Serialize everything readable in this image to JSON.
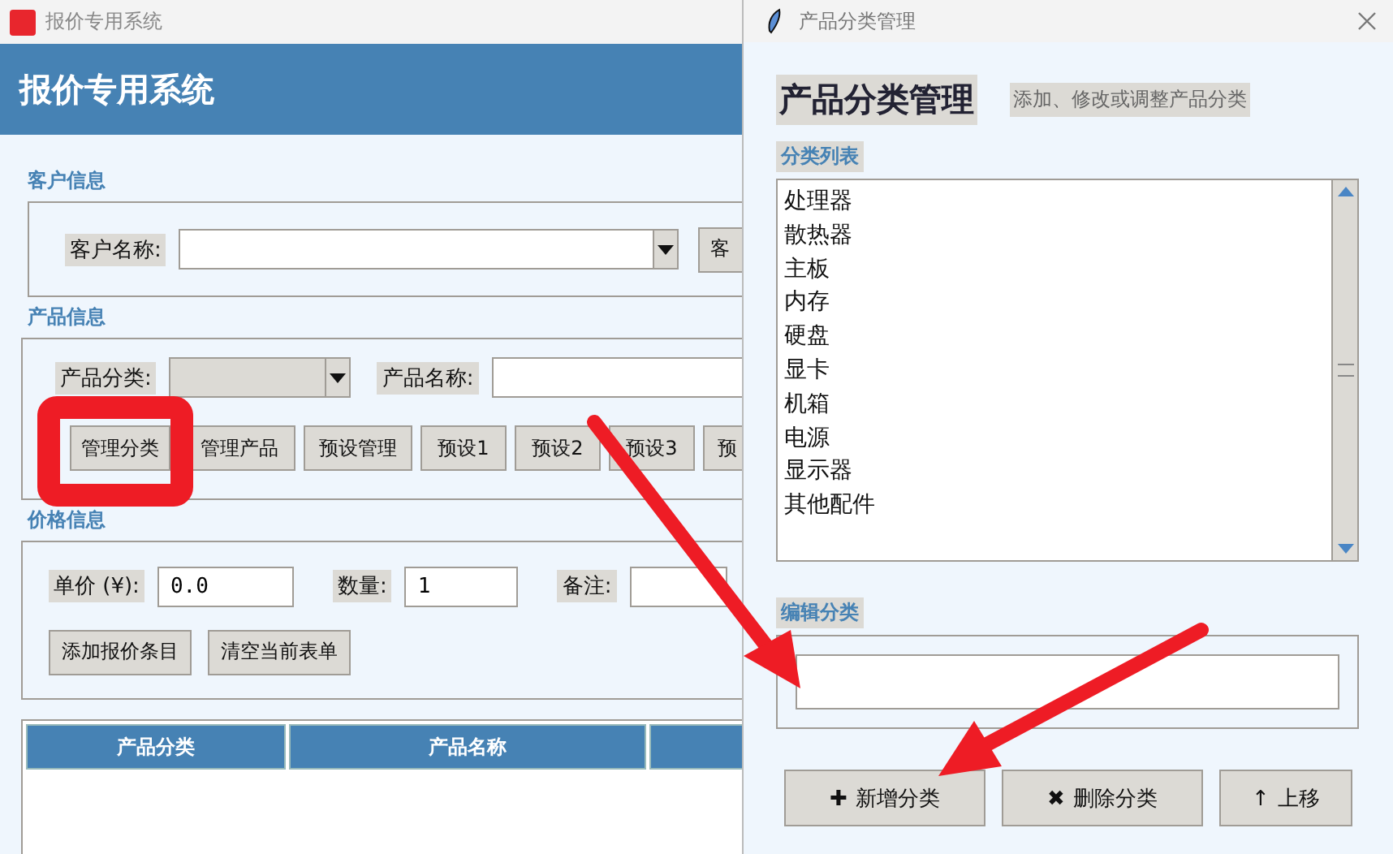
{
  "main_window": {
    "title": "报价专用系统",
    "header": "报价专用系统",
    "customer_section": {
      "label": "客户信息",
      "field_label": "客户名称:",
      "button": "客"
    },
    "product_section": {
      "label": "产品信息",
      "category_label": "产品分类:",
      "name_label": "产品名称:",
      "buttons": [
        "管理分类",
        "管理产品",
        "预设管理",
        "预设1",
        "预设2",
        "预设3",
        "预"
      ]
    },
    "price_section": {
      "label": "价格信息",
      "fields": [
        {
          "label": "单价 (¥):",
          "value": "0.0"
        },
        {
          "label": "数量:",
          "value": "1"
        },
        {
          "label": "备注:"
        }
      ],
      "buttons": [
        "添加报价条目",
        "清空当前表单"
      ]
    },
    "table": {
      "columns": [
        "产品分类",
        "产品名称"
      ]
    }
  },
  "dialog": {
    "title": "产品分类管理",
    "heading": "产品分类管理",
    "subtitle": "添加、修改或调整产品分类",
    "list_label": "分类列表",
    "categories": [
      "处理器",
      "散热器",
      "主板",
      "内存",
      "硬盘",
      "显卡",
      "机箱",
      "电源",
      "显示器",
      "其他配件"
    ],
    "edit_label": "编辑分类",
    "buttons": [
      {
        "icon": "✚",
        "label": "新增分类"
      },
      {
        "icon": "✖",
        "label": "删除分类"
      },
      {
        "icon": "↑",
        "label": "上移"
      }
    ]
  }
}
